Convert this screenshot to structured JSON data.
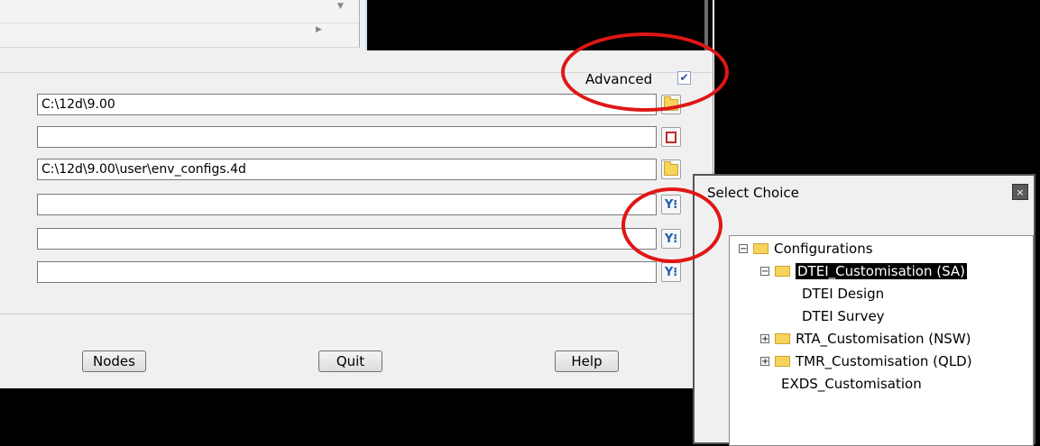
{
  "advanced": {
    "label": "Advanced",
    "checked": true,
    "check_glyph": "✔"
  },
  "fields": [
    {
      "value": "C:\\12d\\9.00",
      "icon": "folder-icon"
    },
    {
      "value": "",
      "icon": "book-icon"
    },
    {
      "value": "C:\\12d\\9.00\\user\\env_configs.4d",
      "icon": "folder-icon"
    },
    {
      "value": "",
      "icon": "filter-icon"
    },
    {
      "value": "",
      "icon": "filter-icon"
    },
    {
      "value": "",
      "icon": "filter-icon"
    }
  ],
  "buttons": {
    "nodes": "Nodes",
    "quit": "Quit",
    "help": "Help"
  },
  "popup": {
    "title": "Select Choice",
    "close_glyph": "×",
    "tree": [
      {
        "label": "Configurations",
        "expander": "⊟",
        "folder": true
      },
      {
        "label": "DTEI_Customisation (SA)",
        "expander": "⊟",
        "folder": true,
        "selected": true
      },
      {
        "label": "DTEI Design"
      },
      {
        "label": "DTEI Survey"
      },
      {
        "label": "RTA_Customisation (NSW)",
        "expander": "⊞",
        "folder": true
      },
      {
        "label": "TMR_Customisation (QLD)",
        "expander": "⊞",
        "folder": true
      },
      {
        "label": "EXDS_Customisation"
      }
    ]
  },
  "annotation_color": "#e01616"
}
